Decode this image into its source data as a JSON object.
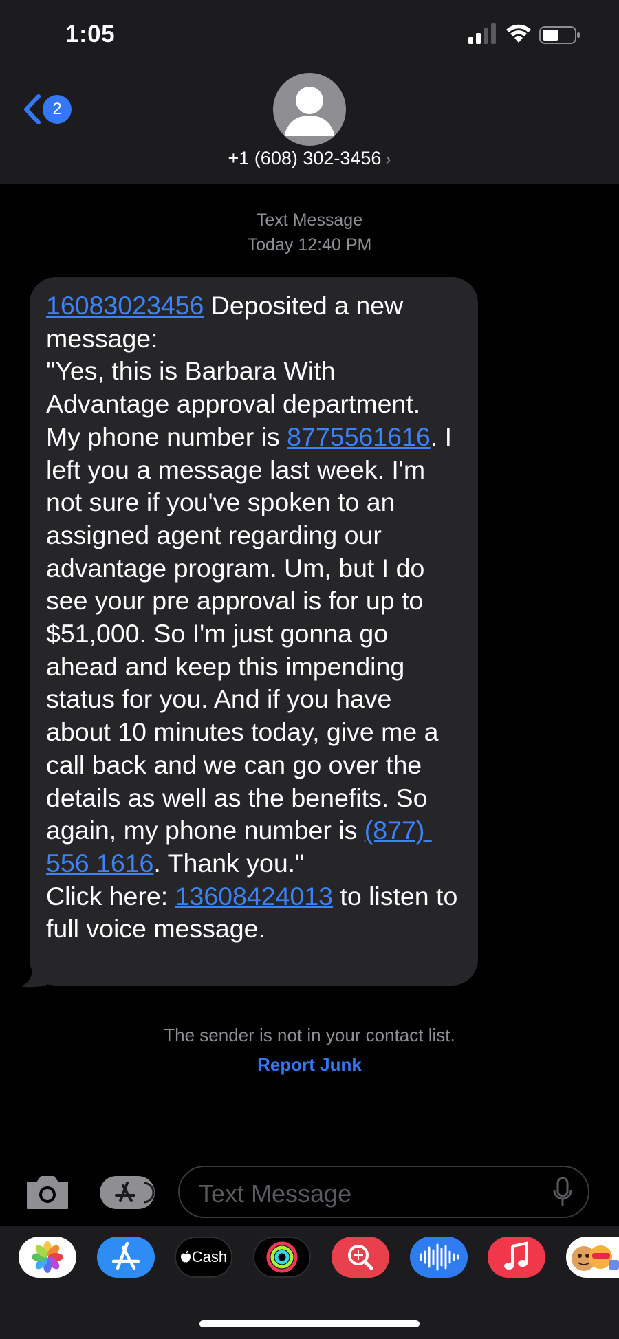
{
  "status_bar": {
    "time": "1:05"
  },
  "header": {
    "back_badge": "2",
    "contact": "+1 (608) 302-3456",
    "contact_chevron": "›"
  },
  "conversation": {
    "meta_type": "Text Message",
    "meta_time": "Today 12:40 PM",
    "message_segments": [
      {
        "text": "16083023456",
        "link": true
      },
      {
        "text": " Deposited a new message:\n\"Yes, this is Barbara With Advantage approval department. My phone number is ",
        "link": false
      },
      {
        "text": "8775561616",
        "link": true
      },
      {
        "text": ". I left you a message last week. I'm not sure if you've spoken to an assigned agent regarding our advantage program. Um, but I do see your pre approval is for up to $51,000. So I'm just gonna go ahead and keep this impending status for you. And if you have about 10 minutes today, give me a call back and we can go over the details as well as the benefits. So again, my phone number is ",
        "link": false
      },
      {
        "text": "(877) 556 1616",
        "link": true
      },
      {
        "text": ". Thank you.\"\nClick here: ",
        "link": false
      },
      {
        "text": "13608424013",
        "link": true
      },
      {
        "text": " to listen to full voice message.",
        "link": false
      }
    ],
    "junk_note": "The sender is not in your contact list.",
    "report_junk": "Report Junk"
  },
  "input": {
    "placeholder": "Text Message"
  },
  "app_drawer": {
    "apps": [
      "photos-icon",
      "app-store-icon",
      "apple-cash-icon",
      "fitness-icon",
      "image-search-icon",
      "audio-waves-icon",
      "music-icon",
      "memoji-icon"
    ],
    "cash_label": "Cash"
  },
  "colors": {
    "link": "#3d82f7",
    "accent": "#3478f6",
    "bubble": "#262628",
    "header": "#1c1c1e"
  }
}
